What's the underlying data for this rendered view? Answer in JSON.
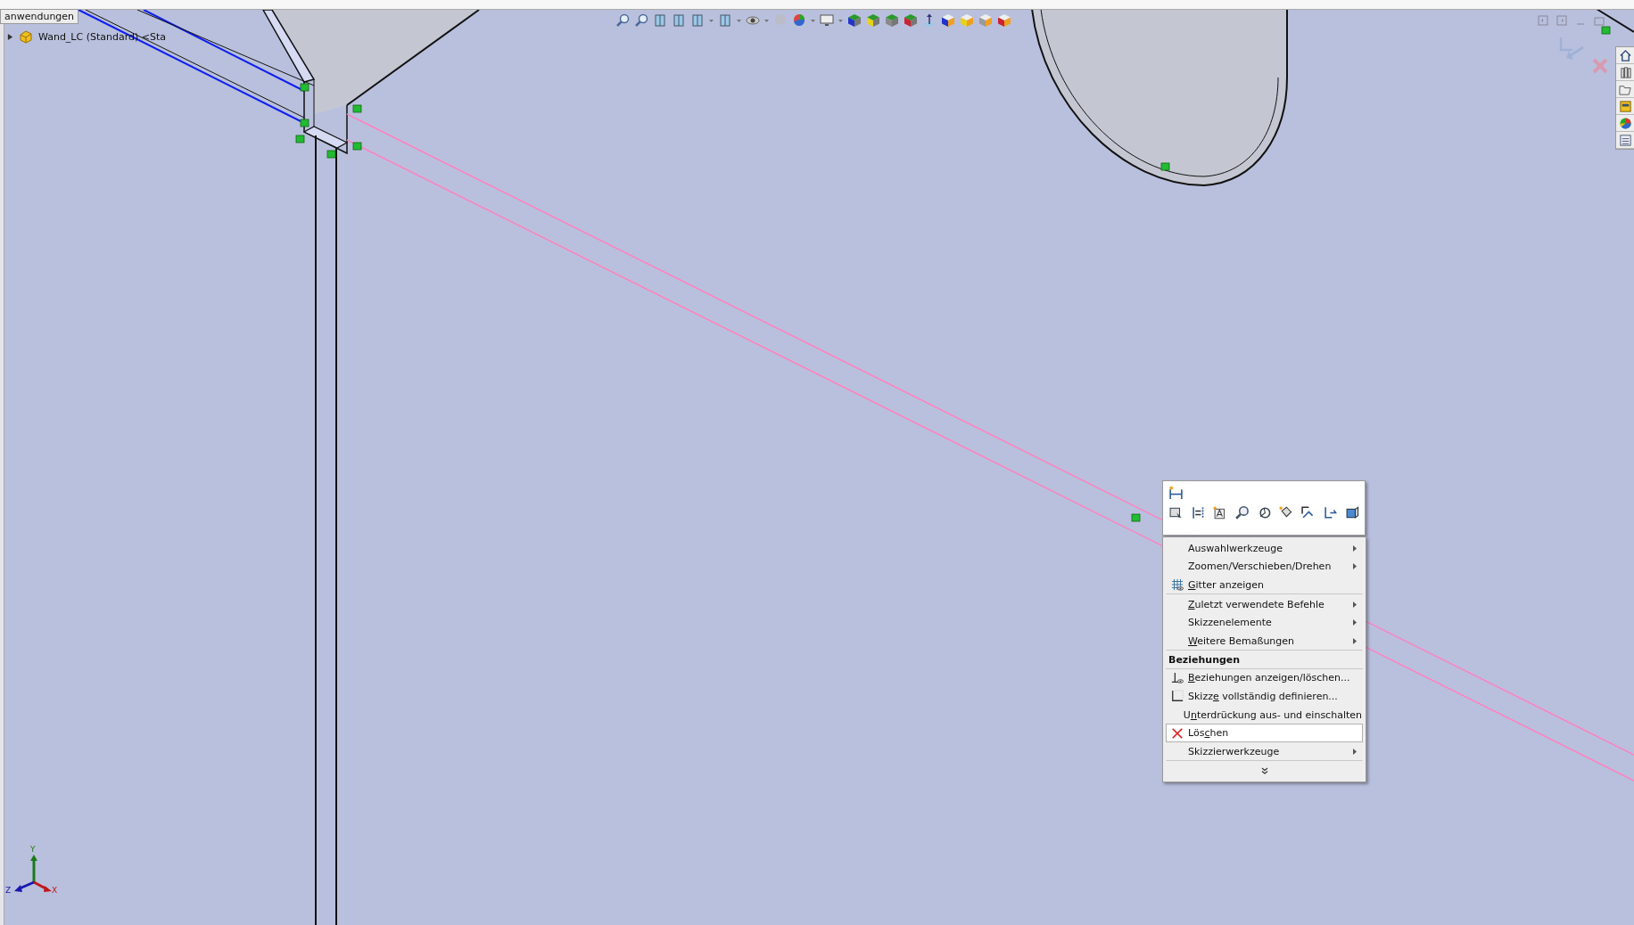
{
  "tooltip": {
    "text": "anwendungen"
  },
  "feature_tree": {
    "items": [
      {
        "label": "Wand_LC (Standard) <Sta",
        "expanded": false
      }
    ]
  },
  "context_menu": {
    "items": [
      {
        "kind": "submenu",
        "label_after": "Auswahlwerkzeuge",
        "selected": false,
        "divider_after": false
      },
      {
        "kind": "submenu",
        "label_after": "Zoomen/Verschieben/Drehen",
        "selected": false,
        "divider_after": false
      },
      {
        "kind": "grid",
        "mnemonic": "G",
        "label_after": "itter anzeigen",
        "selected": false,
        "divider_after": true
      },
      {
        "kind": "submenu",
        "mnemonic": "Z",
        "label_after": "uletzt verwendete Befehle",
        "selected": false,
        "divider_after": false
      },
      {
        "kind": "submenu",
        "label_after": "Skizzenelemente",
        "selected": false,
        "divider_after": false
      },
      {
        "kind": "submenu",
        "mnemonic": "W",
        "label_after": "eitere Bemaßungen",
        "selected": false,
        "divider_after": true
      },
      {
        "kind": "header",
        "label_after": "Beziehungen",
        "divider_after": true
      },
      {
        "kind": "relations",
        "mnemonic": "B",
        "label_after": "eziehungen anzeigen/löschen...",
        "selected": false,
        "divider_after": false
      },
      {
        "kind": "sketch",
        "label_before": "Skizz",
        "mnemonic": "e",
        "label_after": " vollständig definieren...",
        "selected": false,
        "divider_after": false
      },
      {
        "kind": "plain",
        "label_before": "U",
        "mnemonic": "n",
        "label_after": "terdrückung aus- und einschalten",
        "selected": false,
        "divider_after": false
      },
      {
        "kind": "delete",
        "label_before": "Lös",
        "mnemonic": "c",
        "label_after": "hen",
        "selected": true,
        "divider_after": false
      },
      {
        "kind": "submenu",
        "label_after": "Skizzierwerkzeuge",
        "selected": false,
        "divider_after": true
      }
    ]
  },
  "axis_triad": {
    "labels": [
      "Y",
      "X",
      "Z"
    ]
  }
}
